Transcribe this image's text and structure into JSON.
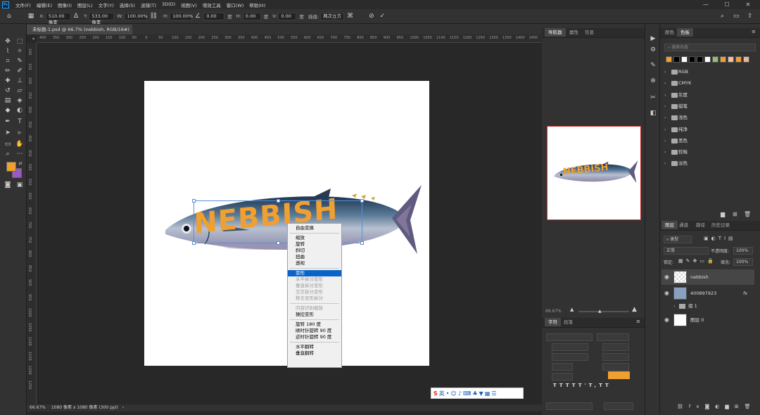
{
  "app": {
    "logo": "Ps"
  },
  "menu": [
    "文件(F)",
    "编辑(E)",
    "图像(I)",
    "图层(L)",
    "文字(Y)",
    "选择(S)",
    "滤镜(T)",
    "3D(D)",
    "视图(V)",
    "增效工具",
    "窗口(W)",
    "帮助(H)"
  ],
  "options": {
    "x_label": "X:",
    "x_value": "510.00 像素",
    "y_label": "Y:",
    "y_value": "533.00 像素",
    "w_label": "W:",
    "w_value": "100.00%",
    "h_label": "H:",
    "h_value": "100.00%",
    "angle_value": "0.00",
    "angle_unit": "度",
    "hskew_label": "H:",
    "hskew_value": "0.00",
    "hskew_unit": "度",
    "vskew_label": "V:",
    "vskew_value": "0.00",
    "vskew_unit": "度",
    "interp_label": "插值:",
    "interp_value": "两次立方"
  },
  "document": {
    "tab_title": "未标题-1.psd @ 66.7% (nebbish, RGB/16#) *",
    "status_zoom": "66.67%",
    "status_info": "1080 像素 x 1080 像素 (300 ppi)",
    "artwork_text": "NEBBISH"
  },
  "ruler": {
    "h": [
      "400",
      "350",
      "300",
      "250",
      "200",
      "150",
      "100",
      "50",
      "0",
      "50",
      "100",
      "150",
      "200",
      "250",
      "300",
      "350",
      "400",
      "450",
      "500",
      "550",
      "600",
      "650",
      "700",
      "750",
      "800",
      "850",
      "900",
      "950",
      "1000",
      "1050",
      "1100",
      "1150",
      "1200",
      "1250",
      "1300",
      "1350",
      "1400",
      "1450"
    ],
    "v": [
      "100",
      "150",
      "200",
      "250",
      "300",
      "350",
      "400",
      "450",
      "500",
      "550",
      "600",
      "650",
      "700",
      "750",
      "800",
      "850",
      "900",
      "950",
      "1000",
      "1050",
      "1100",
      "1150",
      "1200",
      "1250"
    ]
  },
  "context_menu": {
    "groups": [
      [
        {
          "label": "自由变换",
          "state": "normal"
        }
      ],
      [
        {
          "label": "缩放",
          "state": "normal"
        },
        {
          "label": "旋转",
          "state": "normal"
        },
        {
          "label": "斜切",
          "state": "normal"
        },
        {
          "label": "扭曲",
          "state": "normal"
        },
        {
          "label": "透视",
          "state": "normal"
        }
      ],
      [
        {
          "label": "变形",
          "state": "selected"
        },
        {
          "label": "水平拆分变形",
          "state": "disabled"
        },
        {
          "label": "垂直拆分变形",
          "state": "disabled"
        },
        {
          "label": "交叉拆分变形",
          "state": "disabled"
        },
        {
          "label": "移去变形拆分",
          "state": "disabled"
        }
      ],
      [
        {
          "label": "内容识别缩放",
          "state": "disabled"
        },
        {
          "label": "操控变形",
          "state": "normal"
        }
      ],
      [
        {
          "label": "旋转 180 度",
          "state": "normal"
        },
        {
          "label": "顺时针旋转 90 度",
          "state": "normal"
        },
        {
          "label": "逆时针旋转 90 度",
          "state": "normal"
        }
      ],
      [
        {
          "label": "水平翻转",
          "state": "normal"
        },
        {
          "label": "垂直翻转",
          "state": "normal"
        }
      ]
    ]
  },
  "navigator_panel": {
    "tabs": [
      "导航器",
      "属性",
      "信息"
    ],
    "zoom": "66.67%"
  },
  "character_panel": {
    "tabs": [
      "字符",
      "段落"
    ]
  },
  "swatches_panel": {
    "tabs": [
      "颜色",
      "色板"
    ],
    "search_placeholder": "搜索色板",
    "swatches": [
      "#f0a030",
      "#000000",
      "#ffffff",
      "#000000",
      "#000000",
      "#ffffff",
      "#90c070",
      "#f0a030",
      "#f2c0a8",
      "#f0a030",
      "#e8b898"
    ],
    "folders": [
      "RGB",
      "CMYK",
      "灰度",
      "蜡笔",
      "浅色",
      "纯净",
      "黑色",
      "较暗",
      "淡色"
    ]
  },
  "layers_panel": {
    "tabs": [
      "图层",
      "通道",
      "路径",
      "历史记录"
    ],
    "filter_kind": "类型",
    "blend_mode": "正常",
    "opacity_label": "不透明度:",
    "opacity_value": "100%",
    "lock_label": "锁定:",
    "fill_label": "填充:",
    "fill_value": "100%",
    "layers": [
      {
        "name": "nebbish",
        "fx": ""
      },
      {
        "name": "400897923",
        "fx": "fx"
      },
      {
        "name": "组 1",
        "fx": ""
      },
      {
        "name": "图层 0",
        "fx": ""
      }
    ]
  },
  "ime": {
    "label": "英"
  },
  "colors": {
    "orange": "#f0a030",
    "purple": "#9b59c4",
    "accent": "#0a64c8"
  }
}
